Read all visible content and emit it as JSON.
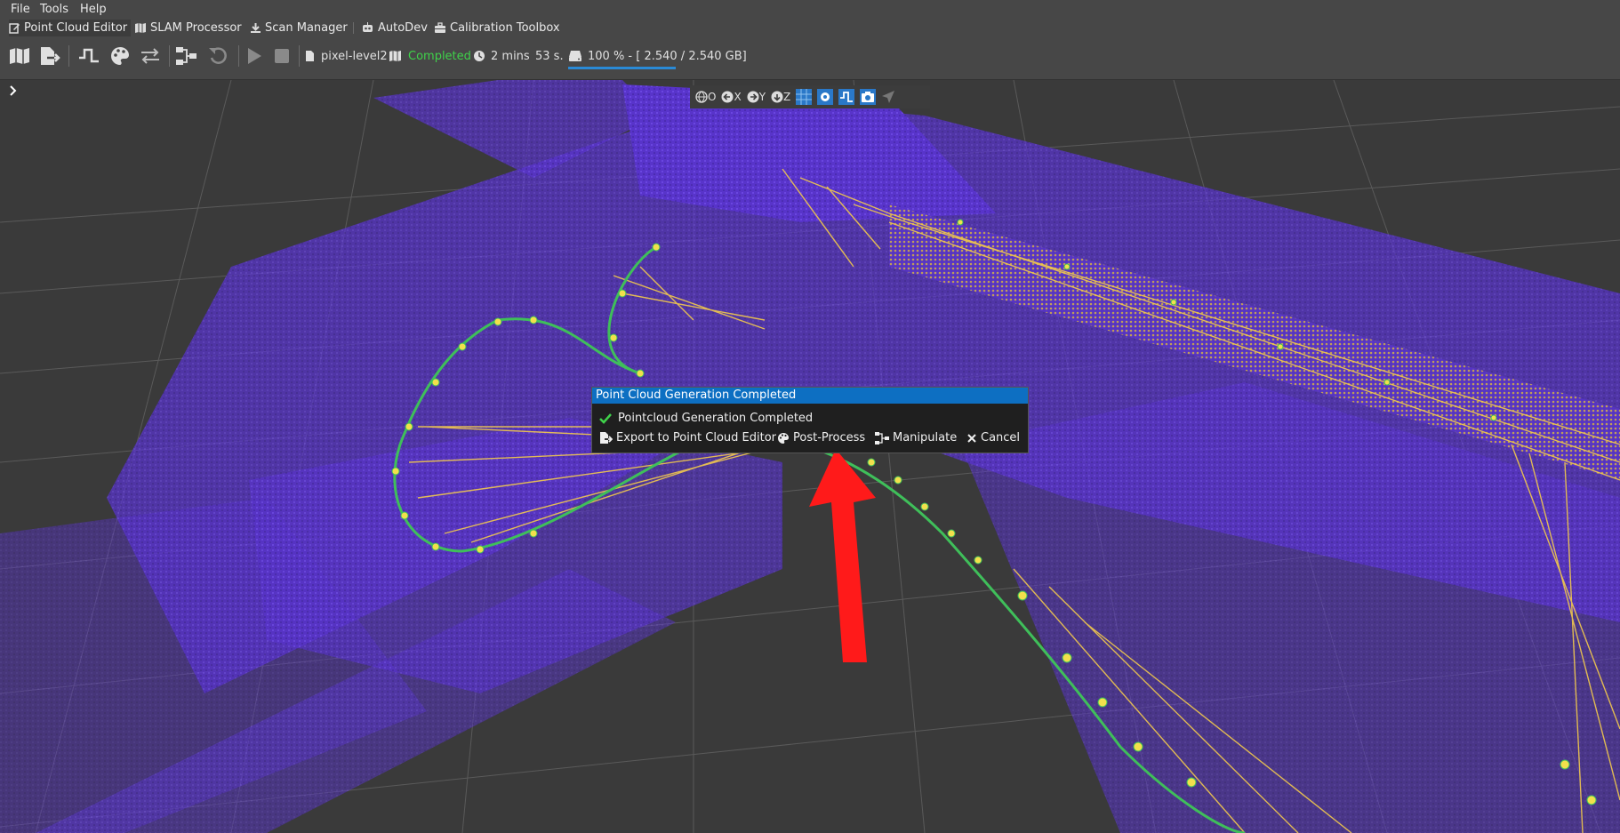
{
  "menubar": {
    "items": [
      "File",
      "Tools",
      "Help"
    ]
  },
  "modes": [
    {
      "label": "Point Cloud Editor",
      "icon": "edit-icon"
    },
    {
      "label": "SLAM Processor",
      "icon": "map-icon"
    },
    {
      "label": "Scan Manager",
      "icon": "download-icon"
    },
    {
      "label": "AutoDev",
      "icon": "robot-icon"
    },
    {
      "label": "Calibration Toolbox",
      "icon": "toolbox-icon"
    }
  ],
  "toolbar": {
    "project_name": "pixel-level2",
    "status": "Completed",
    "status_color": "#3fd24a",
    "elapsed": "2 mins",
    "elapsed_seconds": "53 s.",
    "memory": "100 % - [ 2.540 / 2.540 GB]",
    "memory_progress": 1.0
  },
  "viewbar": {
    "buttons": [
      {
        "label": "O",
        "icon": "globe-icon"
      },
      {
        "label": "X",
        "icon": "arrow-left-circle-icon"
      },
      {
        "label": "Y",
        "icon": "arrow-right-circle-icon"
      },
      {
        "label": "Z",
        "icon": "arrow-down-circle-icon"
      }
    ]
  },
  "dialog": {
    "title": "Point Cloud Generation Completed",
    "message": "Pointcloud Generation Completed",
    "buttons": {
      "export": "Export to Point Cloud Editor",
      "postprocess": "Post-Process",
      "manipulate": "Manipulate",
      "cancel": "Cancel"
    }
  },
  "colors": {
    "accent": "#0d6fc2",
    "pointcloud": "#6a3cf0",
    "trajectory": "#f2c94c",
    "path": "#3fbf5a",
    "arrow": "#ff1a1a"
  }
}
